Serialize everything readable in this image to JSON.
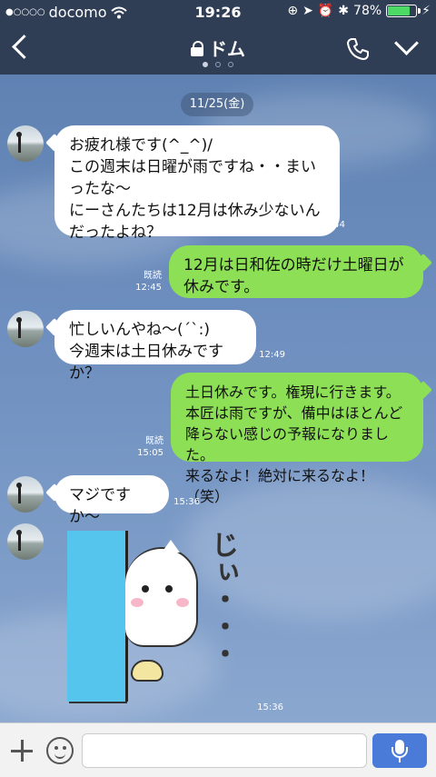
{
  "status_bar": {
    "signal_dots": "●○○○○",
    "carrier": "docomo",
    "time": "19:26",
    "battery": "78%",
    "battery_level": 0.78
  },
  "header": {
    "title": "ドム",
    "pages": 3,
    "active_page": 0
  },
  "chat": {
    "date": "11/25(金)",
    "messages": [
      {
        "side": "in",
        "text": "お疲れ様です(^_^)/\nこの週末は日曜が雨ですね・・まいったな〜\nにーさんたちは12月は休み少ないんだったよね？",
        "time": "12:44"
      },
      {
        "side": "out",
        "text": "12月は日和佐の時だけ土曜日が休みです。",
        "read": "既読",
        "time": "12:45"
      },
      {
        "side": "in",
        "text": "忙しいんやね〜(´`:)\n今週末は土日休みですか？",
        "time": "12:49"
      },
      {
        "side": "out",
        "text": "土日休みです。権現に行きます。\n本匠は雨ですが、備中はほとんど降らない感じの予報になりました。\n来るなよ！絶対に来るなよ！（笑）",
        "read": "既読",
        "time": "15:05"
      },
      {
        "side": "in",
        "text": "マジですか〜",
        "time": "15:36"
      }
    ],
    "sticker": {
      "text": "じぃ・・・",
      "time": "15:36"
    }
  },
  "input_bar": {
    "placeholder": ""
  }
}
